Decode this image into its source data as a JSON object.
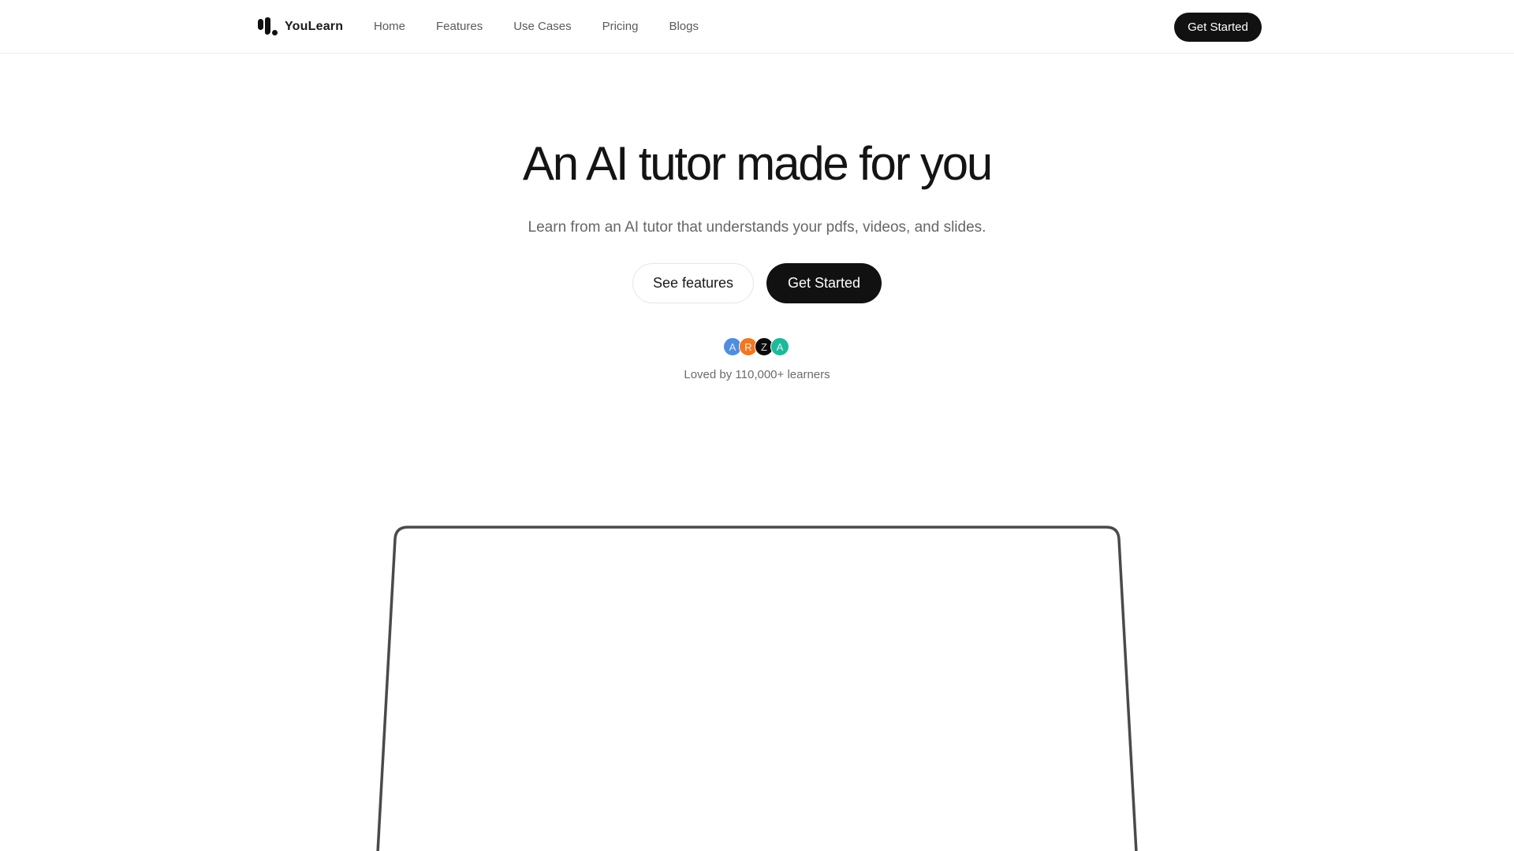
{
  "nav": {
    "brand": "YouLearn",
    "links": [
      {
        "label": "Home"
      },
      {
        "label": "Features"
      },
      {
        "label": "Use Cases"
      },
      {
        "label": "Pricing"
      },
      {
        "label": "Blogs"
      }
    ],
    "cta_label": "Get Started"
  },
  "hero": {
    "title": "An AI tutor made for you",
    "subtitle": "Learn from an AI tutor that understands your pdfs, videos, and slides.",
    "secondary_button": "See features",
    "primary_button": "Get Started",
    "avatars": [
      {
        "initial": "A",
        "color": "#4f8de0"
      },
      {
        "initial": "R",
        "color": "#f07820"
      },
      {
        "initial": "Z",
        "color": "#0b0b0b"
      },
      {
        "initial": "A",
        "color": "#1db99c"
      }
    ],
    "social_proof": "Loved by 110,000+ learners"
  },
  "colors": {
    "primary": "#111111",
    "text_muted": "#666666",
    "frame_stroke": "#4a4a4a"
  }
}
